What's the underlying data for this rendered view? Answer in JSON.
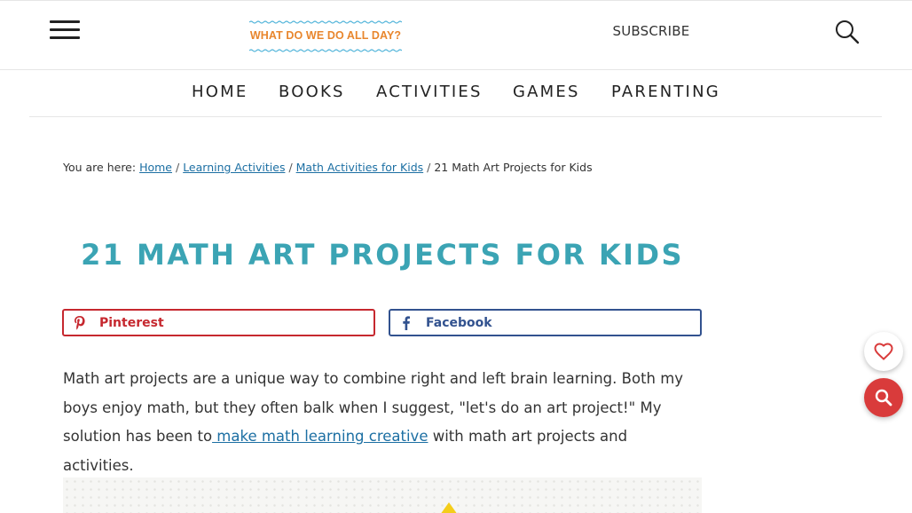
{
  "header": {
    "logo_text": "WHAT DO WE DO ALL DAY?",
    "subscribe_label": "SUBSCRIBE",
    "colors": {
      "logo": "#e8862d",
      "logo_waves": "#4fb3d9"
    }
  },
  "nav": {
    "items": [
      {
        "label": "HOME"
      },
      {
        "label": "BOOKS"
      },
      {
        "label": "ACTIVITIES"
      },
      {
        "label": "GAMES"
      },
      {
        "label": "PARENTING"
      }
    ]
  },
  "breadcrumb": {
    "prefix": "You are here:",
    "links": [
      "Home",
      "Learning Activities",
      "Math Activities for Kids"
    ],
    "separator": "/",
    "current": "21 Math Art Projects for Kids"
  },
  "article": {
    "title": "21 MATH ART PROJECTS FOR KIDS",
    "title_color": "#3ba4b4",
    "share": {
      "pinterest_label": "Pinterest",
      "facebook_label": "Facebook",
      "pinterest_color": "#c6282f",
      "facebook_color": "#32528f"
    },
    "intro_text": "Math art projects are a unique way to combine right and left brain learning. Both my boys enjoy math, but they often balk when I suggest, \"let's do an art project!\" My solution has been to",
    "intro_link": " make math learning creative",
    "intro_suffix": " with math art projects and activities."
  },
  "floating_buttons": {
    "favorite_icon": "heart-icon",
    "zoom_icon": "search-icon",
    "zoom_color": "#d93b3b",
    "heart_color": "#d93b3b"
  },
  "icons": {
    "menu": "hamburger-menu-icon",
    "search": "search-icon",
    "pinterest": "pinterest-icon",
    "facebook": "facebook-icon"
  }
}
